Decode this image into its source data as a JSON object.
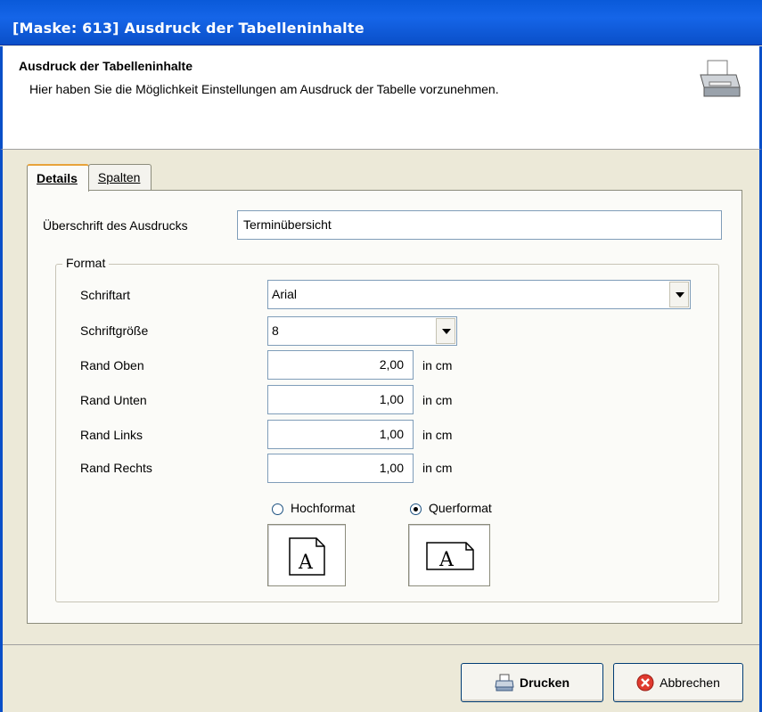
{
  "window": {
    "title": "[Maske: 613] Ausdruck der Tabelleninhalte"
  },
  "header": {
    "title": "Ausdruck der Tabelleninhalte",
    "description": "Hier haben Sie die Möglichkeit Einstellungen am Ausdruck der Tabelle vorzunehmen.",
    "icon": "printer-icon"
  },
  "tabs": [
    {
      "label": "Details",
      "active": true
    },
    {
      "label": "Spalten",
      "active": false
    }
  ],
  "details": {
    "heading_label": "Überschrift des Ausdrucks",
    "heading_value": "Terminübersicht",
    "format_group": "Format",
    "font_label": "Schriftart",
    "font_value": "Arial",
    "size_label": "Schriftgröße",
    "size_value": "8",
    "margins": [
      {
        "label": "Rand Oben",
        "value": "2,00",
        "unit": "in cm"
      },
      {
        "label": "Rand Unten",
        "value": "1,00",
        "unit": "in cm"
      },
      {
        "label": "Rand Links",
        "value": "1,00",
        "unit": "in cm"
      },
      {
        "label": "Rand Rechts",
        "value": "1,00",
        "unit": "in cm"
      }
    ],
    "orientation": {
      "portrait_label": "Hochformat",
      "landscape_label": "Querformat",
      "selected": "Querformat"
    }
  },
  "footer": {
    "print_label": "Drucken",
    "cancel_label": "Abbrechen"
  }
}
